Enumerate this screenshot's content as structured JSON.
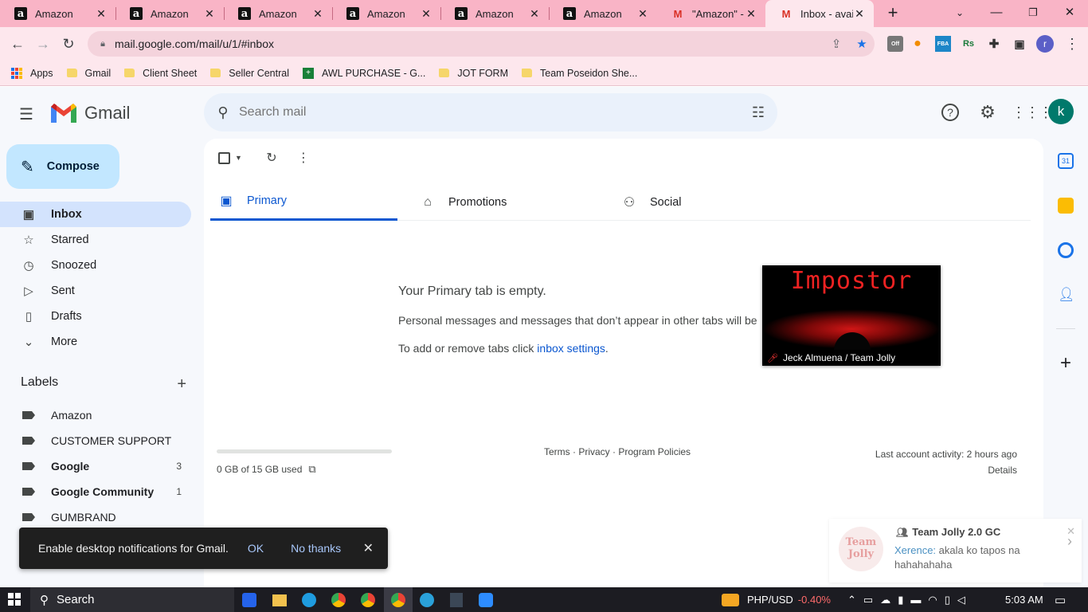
{
  "browser": {
    "tabs": [
      {
        "title": "Amazon",
        "favicon": "amazon-icon"
      },
      {
        "title": "Amazon",
        "favicon": "amazon-icon"
      },
      {
        "title": "Amazon",
        "favicon": "amazon-icon"
      },
      {
        "title": "Amazon",
        "favicon": "amazon-icon"
      },
      {
        "title": "Amazon",
        "favicon": "amazon-icon"
      },
      {
        "title": "Amazon",
        "favicon": "amazon-icon"
      },
      {
        "title": "\"Amazon\" - m",
        "favicon": "gmail-icon"
      },
      {
        "title": "Inbox - availa",
        "favicon": "gmail-icon"
      }
    ],
    "active_tab": 7,
    "url": "mail.google.com/mail/u/1/#inbox",
    "profile_initial": "r",
    "extension_labels": {
      "ext_off": "Off",
      "ext_fba": "FBA",
      "ext_rs": "Rs"
    },
    "bookmarks": [
      {
        "label": "Apps",
        "icon": "apps-grid-icon"
      },
      {
        "label": "Gmail",
        "icon": "folder-icon"
      },
      {
        "label": "Client Sheet",
        "icon": "folder-icon"
      },
      {
        "label": "Seller Central",
        "icon": "folder-icon"
      },
      {
        "label": "AWL PURCHASE - G...",
        "icon": "sheets-icon"
      },
      {
        "label": "JOT FORM",
        "icon": "folder-icon"
      },
      {
        "label": "Team Poseidon She...",
        "icon": "folder-icon"
      }
    ],
    "colors": {
      "tabstrip": "#f9b4c6",
      "toolbar": "#fde7ed"
    }
  },
  "gmail": {
    "brand": "Gmail",
    "search_placeholder": "Search mail",
    "account_initial": "k",
    "compose_label": "Compose",
    "nav": [
      {
        "label": "Inbox",
        "icon": "inbox-icon",
        "active": true
      },
      {
        "label": "Starred",
        "icon": "star-icon"
      },
      {
        "label": "Snoozed",
        "icon": "clock-icon"
      },
      {
        "label": "Sent",
        "icon": "send-icon"
      },
      {
        "label": "Drafts",
        "icon": "draft-icon"
      },
      {
        "label": "More",
        "icon": "chevron-down-icon"
      }
    ],
    "labels_heading": "Labels",
    "labels": [
      {
        "label": "Amazon",
        "count": "",
        "bold": false
      },
      {
        "label": "CUSTOMER SUPPORT",
        "count": "",
        "bold": false
      },
      {
        "label": "Google",
        "count": "3",
        "bold": true
      },
      {
        "label": "Google Community",
        "count": "1",
        "bold": true
      },
      {
        "label": "GUMBRAND",
        "count": "",
        "bold": false
      }
    ],
    "tabs": [
      {
        "label": "Primary",
        "icon": "inbox-tab-icon",
        "active": true
      },
      {
        "label": "Promotions",
        "icon": "tag-icon"
      },
      {
        "label": "Social",
        "icon": "people-icon"
      }
    ],
    "empty": {
      "title": "Your Primary tab is empty.",
      "description": "Personal messages and messages that don’t appear in other tabs will be",
      "hint_prefix": "To add or remove tabs click ",
      "hint_link": "inbox settings",
      "hint_suffix": "."
    },
    "storage": {
      "text": "0 GB of 15 GB used",
      "used_fraction": 0.0
    },
    "footer_links": [
      "Terms",
      "Privacy",
      "Program Policies"
    ],
    "footer_sep": " · ",
    "activity": {
      "line1": "Last account activity: 2 hours ago",
      "line2": "Details"
    },
    "colors": {
      "accent": "#0b57d0",
      "compose": "#c2e7ff",
      "active_nav": "#d3e3fd"
    }
  },
  "video_overlay": {
    "title": "Impostor",
    "participant": "Jeck Almuena / Team Jolly"
  },
  "snackbar": {
    "message": "Enable desktop notifications for Gmail.",
    "ok": "OK",
    "no_thanks": "No thanks"
  },
  "chat_toast": {
    "avatar_text": "Team Jolly",
    "group": "Team Jolly 2.0 GC",
    "sender": "Xerence:",
    "message": " akala ko tapos na hahahahaha"
  },
  "taskbar": {
    "search": "Search",
    "currency_label": "PHP/USD",
    "currency_change": "-0.40%",
    "time": "5:03 AM"
  }
}
